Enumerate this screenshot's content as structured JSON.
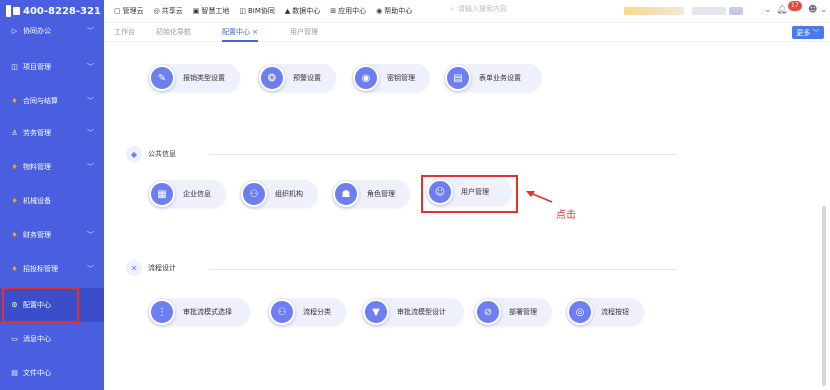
{
  "header": {
    "phone": "400-8228-321",
    "links": [
      {
        "icon": "▢",
        "label": "管理云"
      },
      {
        "icon": "◎",
        "label": "共享云"
      },
      {
        "icon": "▣",
        "label": "智慧工地"
      },
      {
        "icon": "◫",
        "label": "BIM协同"
      },
      {
        "icon": "▲",
        "label": "数据中心"
      },
      {
        "icon": "⊞",
        "label": "应用中心"
      },
      {
        "icon": "◉",
        "label": "帮助中心"
      }
    ],
    "search_placeholder": "请输入搜索内容",
    "notification_count": "17"
  },
  "sidebar": {
    "items": [
      {
        "icon": "▷",
        "label": "协同办公",
        "chevron": "﹀"
      },
      {
        "icon": "◫",
        "label": "项目管理",
        "chevron": "﹀"
      },
      {
        "icon": "♦",
        "label": "合同与结算",
        "chevron": "﹀"
      },
      {
        "icon": "♙",
        "label": "劳务管理",
        "chevron": "﹀"
      },
      {
        "icon": "♦",
        "label": "物料管理",
        "chevron": "﹀"
      },
      {
        "icon": "♦",
        "label": "机械设备",
        "chevron": ""
      },
      {
        "icon": "♦",
        "label": "财务管理",
        "chevron": "﹀"
      },
      {
        "icon": "♦",
        "label": "招投标管理",
        "chevron": "﹀"
      },
      {
        "icon": "⚙",
        "label": "配置中心",
        "chevron": ""
      },
      {
        "icon": "▭",
        "label": "消息中心",
        "chevron": ""
      },
      {
        "icon": "▤",
        "label": "文件中心",
        "chevron": ""
      }
    ]
  },
  "tabs": [
    {
      "label": "工作台"
    },
    {
      "label": "初始化导航"
    },
    {
      "label": "配置中心 ×"
    },
    {
      "label": "用户管理"
    }
  ],
  "more_button": "更多 ﹀",
  "sections": {
    "top_cards": [
      {
        "icon": "✎",
        "label": "报销类型设置"
      },
      {
        "icon": "❂",
        "label": "预警设置"
      },
      {
        "icon": "◉",
        "label": "密钥管理"
      },
      {
        "icon": "▤",
        "label": "表单业务设置"
      }
    ],
    "public_info": {
      "title": "公共信息",
      "cards": [
        {
          "icon": "▦",
          "label": "企业信息"
        },
        {
          "icon": "⚇",
          "label": "组织机构"
        },
        {
          "icon": "☗",
          "label": "角色管理"
        },
        {
          "icon": "☺",
          "label": "用户管理"
        }
      ]
    },
    "workflow": {
      "title": "流程设计",
      "cards": [
        {
          "icon": "⋮",
          "label": "审批流模式选择"
        },
        {
          "icon": "⚇",
          "label": "流程分类"
        },
        {
          "icon": "▼",
          "label": "审批流模型设计"
        },
        {
          "icon": "⊘",
          "label": "部署管理"
        },
        {
          "icon": "◎",
          "label": "流程按钮"
        }
      ]
    }
  },
  "annotation": {
    "click_text": "点击"
  },
  "colors": {
    "sidebar_bg": "#4a5fe0",
    "accent": "#4a5fe0",
    "highlight": "#e5312b"
  }
}
